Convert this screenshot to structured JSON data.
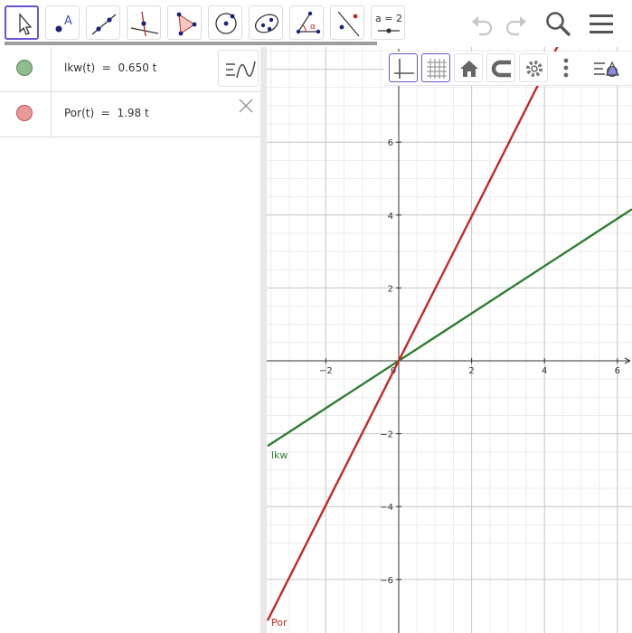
{
  "toolbar": {
    "tools": [
      {
        "name": "move-tool"
      },
      {
        "name": "point-tool"
      },
      {
        "name": "line-tool"
      },
      {
        "name": "perpendicular-tool"
      },
      {
        "name": "polygon-tool"
      },
      {
        "name": "circle-center-tool"
      },
      {
        "name": "conic-tool"
      },
      {
        "name": "angle-tool"
      },
      {
        "name": "reflect-tool"
      },
      {
        "name": "slider-tool",
        "label": "a = 2"
      }
    ],
    "undo_icon": "undo-icon",
    "redo_icon": "redo-icon",
    "search_icon": "search-icon",
    "menu_icon": "menu-icon"
  },
  "algebra": {
    "rows": [
      {
        "definition": "lkw(t)  =  0.650 t",
        "color": "#8fbc8f",
        "border": "#5a8a5a"
      },
      {
        "definition": "Por(t)  =  1.98 t",
        "color": "#e89a9a",
        "border": "#c05050"
      }
    ]
  },
  "graphics": {
    "style_bar": [
      "axes-toggle",
      "grid-toggle",
      "home-icon",
      "magnet-icon",
      "gear-icon",
      "more-icon",
      "style-icon"
    ],
    "accent": "#6557d2"
  },
  "chart_data": {
    "type": "line",
    "xlim": [
      -3.6,
      6.4
    ],
    "ylim": [
      -7.4,
      7.7
    ],
    "grid": true,
    "x_ticks": [
      "−2",
      "0",
      "2",
      "4",
      "6"
    ],
    "y_ticks": [
      "6",
      "4",
      "2",
      "−2",
      "−4",
      "−6"
    ],
    "series": [
      {
        "name": "lkw",
        "slope": 0.65,
        "color": "#2e7d32",
        "label": "lkw"
      },
      {
        "name": "Por",
        "slope": 1.98,
        "color": "#c62828",
        "label": "Por"
      }
    ]
  }
}
